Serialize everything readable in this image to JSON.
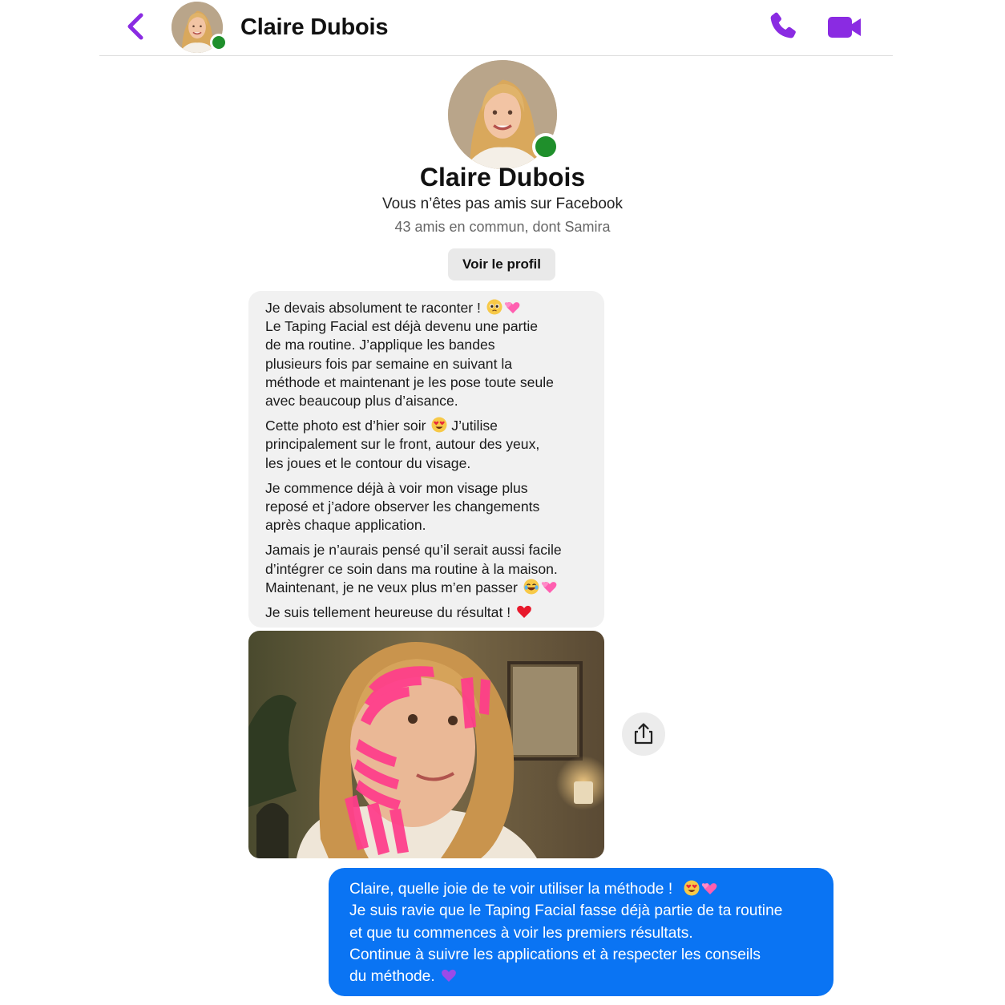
{
  "header": {
    "name": "Claire Dubois",
    "online": true,
    "accent_color": "#8a2be2",
    "icons": [
      "back-arrow-icon",
      "phone-icon",
      "video-camera-icon"
    ]
  },
  "profile": {
    "name": "Claire Dubois",
    "friend_status": "Vous n’êtes pas amis sur Facebook",
    "mutual_friends": "43 amis en commun, dont Samira",
    "view_profile_button": "Voir le profil"
  },
  "messages": {
    "incoming": {
      "bubble_color": "#f1f1f1",
      "paragraphs": [
        {
          "lines": [
            "Je devais absolument te raconter !",
            "Le Taping Facial est déjà devenu une partie",
            "de ma routine. J’applique les bandes",
            "plusieurs fois par semaine en suivant la",
            "méthode et maintenant je les pose toute seule",
            "avec beaucoup plus d’aisance."
          ]
        },
        {
          "lines": [
            "Cette photo est d’hier soir",
            "J’utilise",
            "principalement sur le front, autour des yeux,",
            "les joues et le contour du visage."
          ]
        },
        {
          "lines": [
            "Je commence déjà à voir mon visage plus",
            "reposé et j’adore observer les changements",
            "après chaque application."
          ]
        },
        {
          "lines": [
            "Jamais je n’aurais pensé qu’il serait aussi facile",
            "d’intégrer ce soin dans ma routine à la maison.",
            "Maintenant, je ne veux plus m’en passer"
          ]
        },
        {
          "lines": [
            "Je suis tellement heureuse du résultat !"
          ]
        }
      ],
      "emojis": [
        "pleading-face",
        "two-hearts",
        "heart-eyes",
        "tears-of-joy",
        "two-hearts",
        "red-heart"
      ]
    },
    "photo": {
      "description_icon": "photo-taped-face",
      "share_icon": "share-icon"
    },
    "outgoing": {
      "bubble_color": "#0a74f3",
      "lines": [
        "Claire, quelle joie de te voir utiliser la méthode !",
        "Je suis ravie que le Taping Facial fasse déjà partie de ta routine",
        "et que tu commences à voir les premiers résultats.",
        "Continue à suivre les applications et à respecter les conseils",
        "du méthode."
      ],
      "emojis": [
        "heart-eyes",
        "two-hearts",
        "purple-heart"
      ]
    }
  }
}
